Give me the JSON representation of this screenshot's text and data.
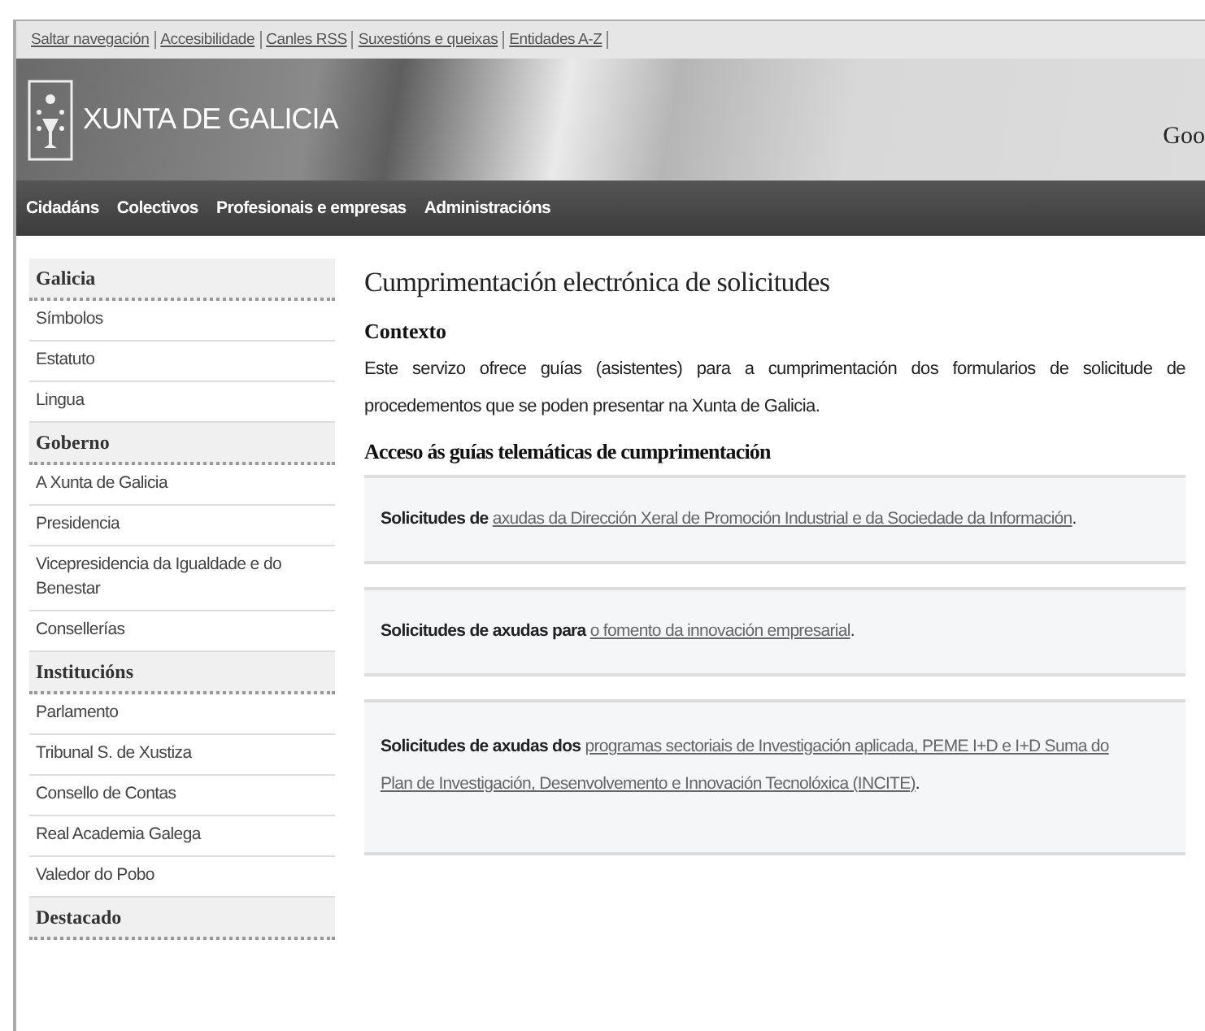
{
  "top_links": [
    "Saltar navegación",
    "Accesibilidade",
    "Canles RSS",
    "Suxestións e queixas",
    "Entidades A-Z"
  ],
  "header": {
    "title": "XUNTA DE GALICIA",
    "search_label": "Goo"
  },
  "nav": [
    "Cidadáns",
    "Colectivos",
    "Profesionais e empresas",
    "Administracións"
  ],
  "sidebar": [
    {
      "heading": "Galicia",
      "items": [
        "Símbolos",
        "Estatuto",
        "Lingua"
      ]
    },
    {
      "heading": "Goberno",
      "items": [
        "A Xunta de Galicia",
        "Presidencia",
        "Vicepresidencia da Igualdade e do Benestar",
        "Consellerías"
      ]
    },
    {
      "heading": "Institucións",
      "items": [
        "Parlamento",
        "Tribunal S. de Xustiza",
        "Consello de Contas",
        "Real Academia Galega",
        "Valedor do Pobo"
      ]
    },
    {
      "heading": "Destacado"
    }
  ],
  "main": {
    "title": "Cumprimentación electrónica de solicitudes",
    "context_heading": "Contexto",
    "context_text": "Este servizo ofrece guías (asistentes) para a cumprimentación dos formularios de solicitude de procedementos que se poden presentar na Xunta de Galicia.",
    "access_heading": "Acceso ás guías telemáticas de cumprimentación",
    "entries": [
      {
        "prefix": "Solicitudes de",
        "link_lines": [
          "axudas da Dirección Xeral de Promoción Industrial e da Sociedade da Información"
        ],
        "suffix": "."
      },
      {
        "prefix": "Solicitudes de axudas para",
        "link_lines": [
          "o fomento da innovación empresarial"
        ],
        "suffix": "."
      },
      {
        "prefix": "Solicitudes de axudas dos",
        "link_lines": [
          "programas sectoriais de Investigación aplicada, PEME I+D e I+D Suma do",
          "Plan de Investigación, Desenvolvemento e Innovación Tecnolóxica (INCITE)"
        ],
        "suffix": "."
      }
    ]
  }
}
